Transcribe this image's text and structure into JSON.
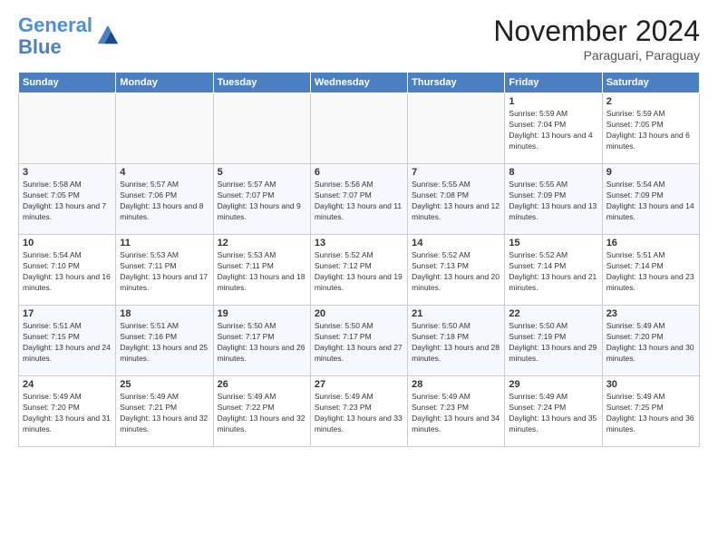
{
  "logo": {
    "line1": "General",
    "line2": "Blue"
  },
  "header": {
    "month": "November 2024",
    "location": "Paraguari, Paraguay"
  },
  "weekdays": [
    "Sunday",
    "Monday",
    "Tuesday",
    "Wednesday",
    "Thursday",
    "Friday",
    "Saturday"
  ],
  "weeks": [
    [
      {
        "day": "",
        "info": ""
      },
      {
        "day": "",
        "info": ""
      },
      {
        "day": "",
        "info": ""
      },
      {
        "day": "",
        "info": ""
      },
      {
        "day": "",
        "info": ""
      },
      {
        "day": "1",
        "info": "Sunrise: 5:59 AM\nSunset: 7:04 PM\nDaylight: 13 hours and 4 minutes."
      },
      {
        "day": "2",
        "info": "Sunrise: 5:59 AM\nSunset: 7:05 PM\nDaylight: 13 hours and 6 minutes."
      }
    ],
    [
      {
        "day": "3",
        "info": "Sunrise: 5:58 AM\nSunset: 7:05 PM\nDaylight: 13 hours and 7 minutes."
      },
      {
        "day": "4",
        "info": "Sunrise: 5:57 AM\nSunset: 7:06 PM\nDaylight: 13 hours and 8 minutes."
      },
      {
        "day": "5",
        "info": "Sunrise: 5:57 AM\nSunset: 7:07 PM\nDaylight: 13 hours and 9 minutes."
      },
      {
        "day": "6",
        "info": "Sunrise: 5:56 AM\nSunset: 7:07 PM\nDaylight: 13 hours and 11 minutes."
      },
      {
        "day": "7",
        "info": "Sunrise: 5:55 AM\nSunset: 7:08 PM\nDaylight: 13 hours and 12 minutes."
      },
      {
        "day": "8",
        "info": "Sunrise: 5:55 AM\nSunset: 7:09 PM\nDaylight: 13 hours and 13 minutes."
      },
      {
        "day": "9",
        "info": "Sunrise: 5:54 AM\nSunset: 7:09 PM\nDaylight: 13 hours and 14 minutes."
      }
    ],
    [
      {
        "day": "10",
        "info": "Sunrise: 5:54 AM\nSunset: 7:10 PM\nDaylight: 13 hours and 16 minutes."
      },
      {
        "day": "11",
        "info": "Sunrise: 5:53 AM\nSunset: 7:11 PM\nDaylight: 13 hours and 17 minutes."
      },
      {
        "day": "12",
        "info": "Sunrise: 5:53 AM\nSunset: 7:11 PM\nDaylight: 13 hours and 18 minutes."
      },
      {
        "day": "13",
        "info": "Sunrise: 5:52 AM\nSunset: 7:12 PM\nDaylight: 13 hours and 19 minutes."
      },
      {
        "day": "14",
        "info": "Sunrise: 5:52 AM\nSunset: 7:13 PM\nDaylight: 13 hours and 20 minutes."
      },
      {
        "day": "15",
        "info": "Sunrise: 5:52 AM\nSunset: 7:14 PM\nDaylight: 13 hours and 21 minutes."
      },
      {
        "day": "16",
        "info": "Sunrise: 5:51 AM\nSunset: 7:14 PM\nDaylight: 13 hours and 23 minutes."
      }
    ],
    [
      {
        "day": "17",
        "info": "Sunrise: 5:51 AM\nSunset: 7:15 PM\nDaylight: 13 hours and 24 minutes."
      },
      {
        "day": "18",
        "info": "Sunrise: 5:51 AM\nSunset: 7:16 PM\nDaylight: 13 hours and 25 minutes."
      },
      {
        "day": "19",
        "info": "Sunrise: 5:50 AM\nSunset: 7:17 PM\nDaylight: 13 hours and 26 minutes."
      },
      {
        "day": "20",
        "info": "Sunrise: 5:50 AM\nSunset: 7:17 PM\nDaylight: 13 hours and 27 minutes."
      },
      {
        "day": "21",
        "info": "Sunrise: 5:50 AM\nSunset: 7:18 PM\nDaylight: 13 hours and 28 minutes."
      },
      {
        "day": "22",
        "info": "Sunrise: 5:50 AM\nSunset: 7:19 PM\nDaylight: 13 hours and 29 minutes."
      },
      {
        "day": "23",
        "info": "Sunrise: 5:49 AM\nSunset: 7:20 PM\nDaylight: 13 hours and 30 minutes."
      }
    ],
    [
      {
        "day": "24",
        "info": "Sunrise: 5:49 AM\nSunset: 7:20 PM\nDaylight: 13 hours and 31 minutes."
      },
      {
        "day": "25",
        "info": "Sunrise: 5:49 AM\nSunset: 7:21 PM\nDaylight: 13 hours and 32 minutes."
      },
      {
        "day": "26",
        "info": "Sunrise: 5:49 AM\nSunset: 7:22 PM\nDaylight: 13 hours and 32 minutes."
      },
      {
        "day": "27",
        "info": "Sunrise: 5:49 AM\nSunset: 7:23 PM\nDaylight: 13 hours and 33 minutes."
      },
      {
        "day": "28",
        "info": "Sunrise: 5:49 AM\nSunset: 7:23 PM\nDaylight: 13 hours and 34 minutes."
      },
      {
        "day": "29",
        "info": "Sunrise: 5:49 AM\nSunset: 7:24 PM\nDaylight: 13 hours and 35 minutes."
      },
      {
        "day": "30",
        "info": "Sunrise: 5:49 AM\nSunset: 7:25 PM\nDaylight: 13 hours and 36 minutes."
      }
    ]
  ]
}
